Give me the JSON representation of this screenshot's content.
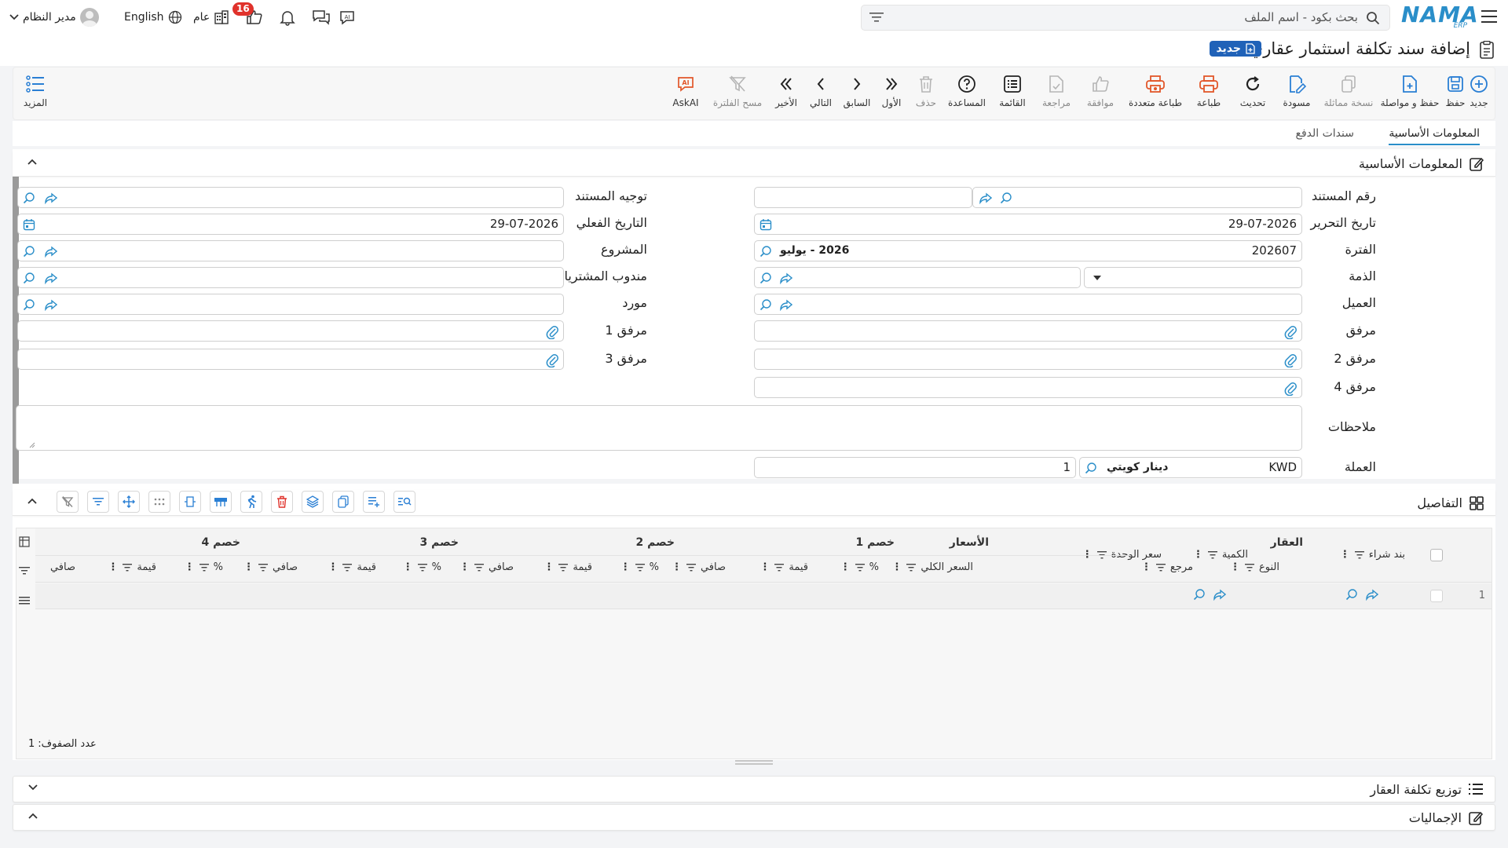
{
  "topbar": {
    "logo_text": "NAMA",
    "logo_sub": "ERP",
    "search_placeholder": "بحث بكود - اسم الملف",
    "notifications_count": "16",
    "language_label": "English",
    "company_label": "عام",
    "user_name": "مدير النظام"
  },
  "page": {
    "title": "إضافة سند تكلفة استثمار عقاري",
    "status_badge": "جديد"
  },
  "toolbar": {
    "items": [
      {
        "label": "جديد"
      },
      {
        "label": "حفظ"
      },
      {
        "label": "حفظ و مواصلة"
      },
      {
        "label": "نسخة مماثلة"
      },
      {
        "label": "مسودة"
      },
      {
        "label": "تحديث"
      },
      {
        "label": "طباعة"
      },
      {
        "label": "طباعة متعددة"
      },
      {
        "label": "موافقة"
      },
      {
        "label": "مراجعة"
      },
      {
        "label": "القائمة"
      },
      {
        "label": "المساعدة"
      },
      {
        "label": "حذف"
      },
      {
        "label": "الأول"
      },
      {
        "label": "السابق"
      },
      {
        "label": "التالي"
      },
      {
        "label": "الأخير"
      },
      {
        "label": "مسح الفلترة"
      },
      {
        "label": "AskAI"
      }
    ],
    "more_label": "المزيد"
  },
  "tabs": [
    {
      "label": "المعلومات الأساسية"
    },
    {
      "label": "سندات الدفع"
    }
  ],
  "basic_info": {
    "section_title": "المعلومات الأساسية",
    "labels": {
      "doc_number": "رقم المستند",
      "issue_date": "تاريخ التحرير",
      "period": "الفترة",
      "account": "الذمة",
      "customer": "العميل",
      "attachment": "مرفق",
      "attachment2": "مرفق 2",
      "attachment4": "مرفق 4",
      "notes": "ملاحظات",
      "currency": "العملة",
      "doc_direction": "توجيه المستند",
      "actual_date": "التاريخ الفعلي",
      "project": "المشروع",
      "purchase_rep": "مندوب المشتريات",
      "supplier": "مورد",
      "attachment1": "مرفق 1",
      "attachment3": "مرفق 3"
    },
    "values": {
      "issue_date": "29-07-2026",
      "actual_date": "29-07-2026",
      "period_code": "202607",
      "period_name": "2026 - يوليو",
      "currency_code": "KWD",
      "currency_name": "دينار كويتي",
      "currency_rate": "1"
    }
  },
  "details": {
    "section_title": "التفاصيل",
    "group_headers": {
      "purchase_item": "بند شراء",
      "property": "العقار",
      "quantity": "الكمية",
      "unit_price": "سعر الوحدة",
      "prices": "الأسعار",
      "disc1": "خصم 1",
      "disc2": "خصم 2",
      "disc3": "خصم 3",
      "disc4": "خصم 4"
    },
    "sub_headers": {
      "type": "النوع",
      "ref": "مرجع",
      "total_price": "السعر الكلي",
      "pct": "%",
      "value": "قيمة",
      "net": "صافي"
    },
    "rows": [
      {
        "num": "1"
      }
    ],
    "rows_count_label": "عدد الصفوف:",
    "rows_count": "1"
  },
  "cost_distribution": {
    "section_title": "توزيع تكلفة العقار"
  },
  "totals": {
    "section_title": "الإجماليات"
  },
  "colors": {
    "brand": "#2a8ec9",
    "badge_blue": "#2062b8",
    "toolbar_blue": "#2a7fd4",
    "print_orange": "#e2572a",
    "notif_red": "#e0322b"
  }
}
